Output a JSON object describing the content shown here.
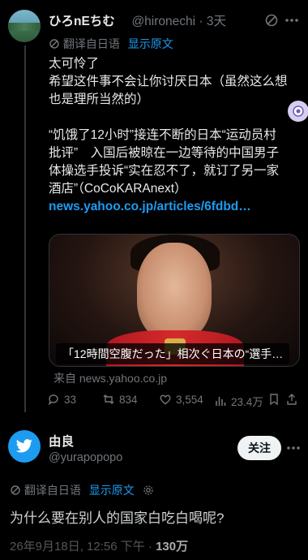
{
  "tweet1": {
    "display_name": "ひろnEちむ",
    "handle": "@hironechi",
    "time": "3天",
    "translated_from": "翻译自日语",
    "show_original": "显示原文",
    "lines": [
      "太可怜了",
      "希望这件事不会让你讨厌日本（虽然这么想",
      "也是理所当然的）",
      "",
      "“饥饿了12小时”接连不断的日本“运动员村",
      "批评”　入国后被晾在一边等待的中国男子",
      "体操选手投诉“实在忍不了，就订了另一家",
      "酒店”（CoCoKARAnext）"
    ],
    "link": "news.yahoo.co.jp/articles/6fdbd…",
    "card_caption": "「12時間空腹だった」相次ぐ日本の“選手…",
    "source": "来自 news.yahoo.co.jp",
    "actions": {
      "replies": "33",
      "retweets": "834",
      "likes": "3,554",
      "views": "23.4万"
    }
  },
  "tweet2": {
    "display_name": "由良",
    "handle": "@yurapopopo",
    "follow_label": "关注",
    "translated_from": "翻译自日语",
    "show_original": "显示原文",
    "text": "为什么要在别人的国家白吃白喝呢?",
    "meta_prefix": "26年9月18日, 12:56 下午 · ",
    "meta_views": "130万"
  },
  "colors": {
    "background": "#000000",
    "text": "#e7e9ea",
    "muted": "#71767b",
    "link": "#1d9bf0"
  }
}
